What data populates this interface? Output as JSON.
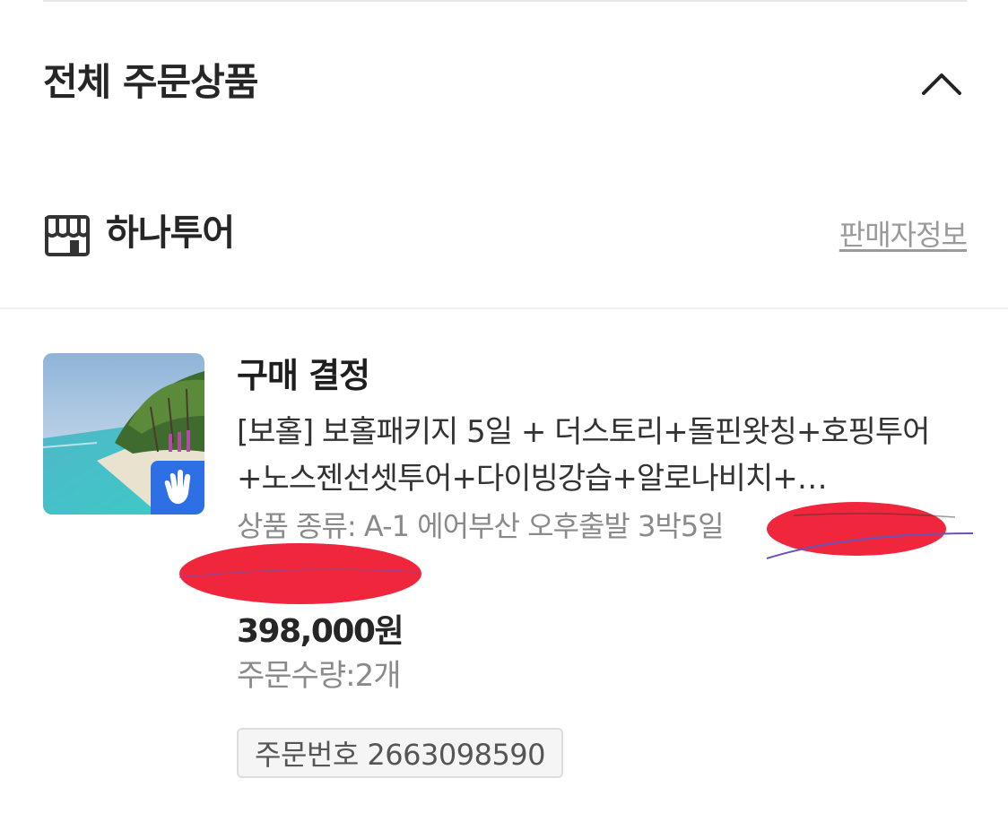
{
  "section": {
    "title": "전체 주문상품"
  },
  "seller": {
    "icon": "store-icon",
    "name": "하나투어",
    "info_link": "판매자정보"
  },
  "order_item": {
    "thumbnail_badge_icon": "hand-wave-icon",
    "status": "구매 결정",
    "product_name": "[보홀] 보홀패키지 5일 + 더스토리+돌핀왓칭+호핑투어+노스젠선셋투어+다이빙강습+알로나비치+…",
    "option": "상품 종류: A-1 에어부산 오후출발 3박5일",
    "price": "398,000원",
    "quantity": "주문수량:2개",
    "order_number": "주문번호 2663098590"
  },
  "colors": {
    "badge": "#2f6fe6",
    "redaction": "#f0263c"
  }
}
